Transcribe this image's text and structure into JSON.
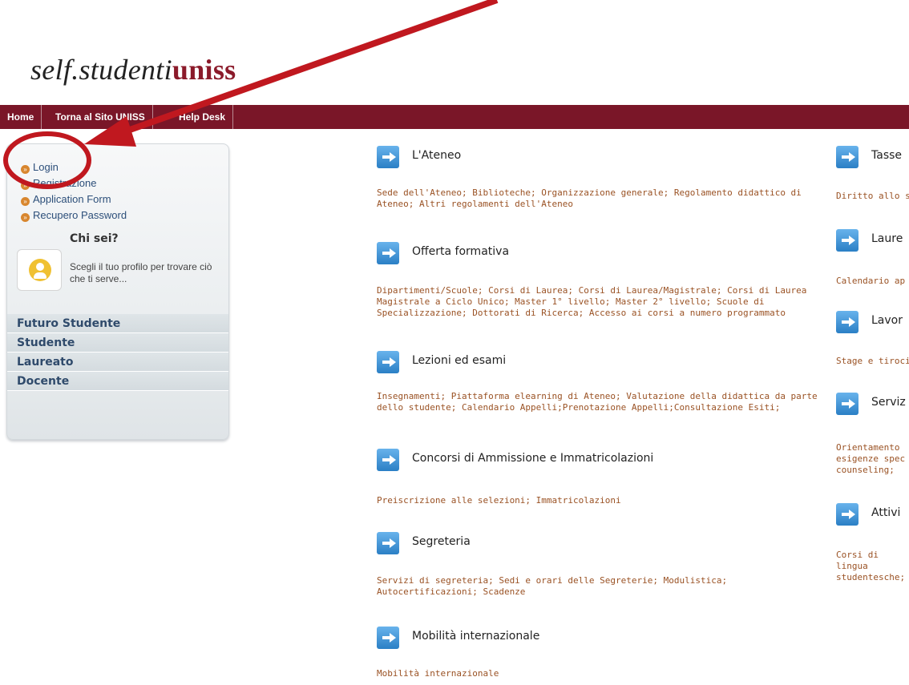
{
  "logo": {
    "part1": "self.studenti",
    "part2": "uniss"
  },
  "topnav": {
    "home": "Home",
    "torna": "Torna al Sito UNISS",
    "help": "Help Desk"
  },
  "sidebar": {
    "links": [
      "Login",
      "Registrazione",
      "Application Form",
      "Recupero Password"
    ],
    "chisei": {
      "title": "Chi sei?",
      "desc": "Scegli il tuo profilo per trovare ciò che ti serve..."
    },
    "categories": [
      "Futuro Studente",
      "Studente",
      "Laureato",
      "Docente"
    ]
  },
  "sections": [
    {
      "title": "L'Ateneo",
      "links": "Sede dell'Ateneo; Biblioteche; Organizzazione generale; Regolamento didattico di Ateneo; Altri regolamenti dell'Ateneo"
    },
    {
      "title": "Offerta formativa",
      "links": "Dipartimenti/Scuole; Corsi di Laurea; Corsi di Laurea/Magistrale; Corsi di Laurea Magistrale a Ciclo Unico; Master 1° livello; Master 2° livello; Scuole di Specializzazione; Dottorati di Ricerca; Accesso ai corsi a numero programmato"
    },
    {
      "title": "Lezioni ed esami",
      "links": "Insegnamenti; Piattaforma elearning di Ateneo; Valutazione della didattica da parte dello studente; Calendario Appelli;Prenotazione Appelli;Consultazione Esiti;"
    },
    {
      "title": "Concorsi di Ammissione e Immatricolazioni",
      "links": "Preiscrizione alle selezioni; Immatricolazioni"
    },
    {
      "title": "Segreteria",
      "links": "Servizi di segreteria; Sedi e orari delle Segreterie; Modulistica; Autocertificazioni; Scadenze"
    },
    {
      "title": "Mobilità internazionale",
      "links": "Mobilità internazionale"
    }
  ],
  "right_sections": [
    {
      "title": "Tasse",
      "links": "Diritto allo st"
    },
    {
      "title": "Laure",
      "links": "Calendario ap"
    },
    {
      "title": "Lavor",
      "links": "Stage e tiroci"
    },
    {
      "title": "Serviz",
      "links": "Orientamento esigenze spec counseling;"
    },
    {
      "title": "Attivi",
      "links": "Corsi di lingua studentesche;"
    }
  ],
  "colors": {
    "nav": "#7a1628",
    "logo_accent": "#8b1a2a",
    "link": "#9a5224",
    "annotation": "#c0181f"
  }
}
